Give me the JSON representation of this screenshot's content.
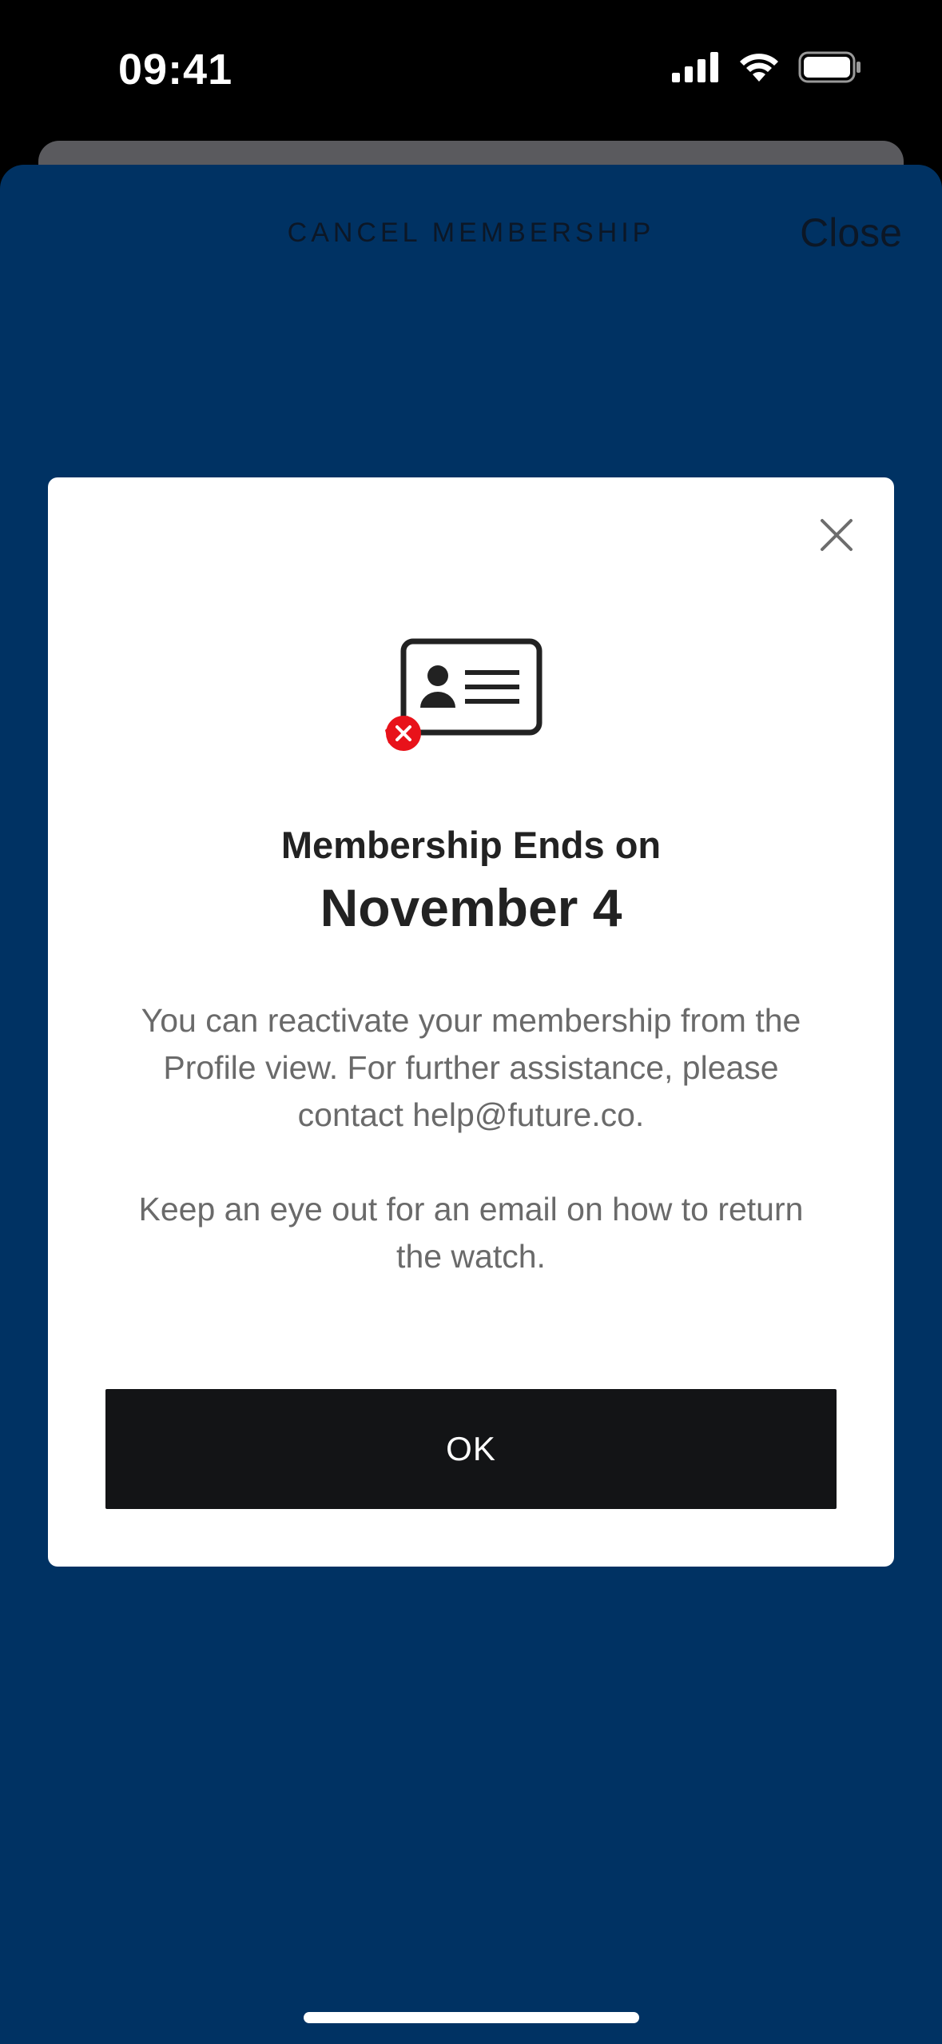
{
  "status_bar": {
    "time": "09:41",
    "icons": [
      "cellular-signal-icon",
      "wifi-icon",
      "battery-icon"
    ]
  },
  "sheet": {
    "title": "CANCEL MEMBERSHIP",
    "close_label": "Close",
    "background_color": "#003263"
  },
  "modal": {
    "close_icon": "close-icon",
    "illustration_icon": "membership-card-cancelled-icon",
    "heading": "Membership Ends on",
    "date": "November 4",
    "body": {
      "paragraph_1": "You can reactivate your membership from the Profile view. For further assistance, please contact help@future.co.",
      "paragraph_2": "Keep an eye out for an email on how to return the watch."
    },
    "ok_label": "OK",
    "colors": {
      "button": "#131416",
      "error_badge": "#e8121a"
    }
  }
}
